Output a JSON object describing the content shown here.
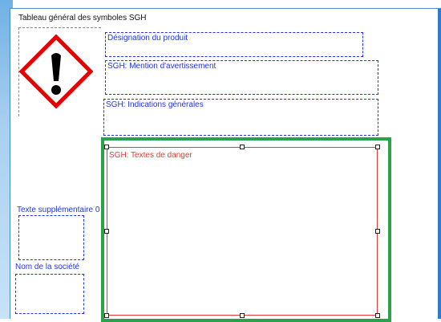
{
  "title": "Tableau général des symboles SGH",
  "fields": {
    "product_designation": "Désignation du produit",
    "signal_word": "SGH: Mention d'avertissement",
    "general_indications": "SGH: Indications générales",
    "hazard_texts": "SGH: Textes de danger",
    "additional_text": "Texte supplémentaire 0",
    "company_name": "Nom de la société"
  },
  "pictogram": {
    "icon": "exclamation-mark-icon",
    "border_color": "#e60000"
  },
  "colors": {
    "field_border": "#1f34e8",
    "selection_border": "#2aa14a",
    "hazard_box_border": "#e53935"
  }
}
